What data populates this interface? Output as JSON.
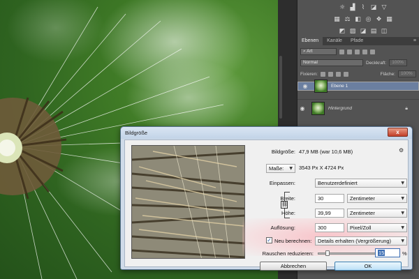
{
  "colors": {
    "selected_layer": "#6b7fa0",
    "dialog_frame": "#cfdbe9",
    "accent": "#3b6db3"
  },
  "panels": {
    "tabs": [
      "Ebenen",
      "Kanäle",
      "Pfade"
    ],
    "filter_label": "Art",
    "blend_mode": "Normal",
    "opacity_label": "Deckkraft:",
    "opacity_value": "100%",
    "lock_label": "Fixieren:",
    "fill_label": "Fläche:",
    "fill_value": "100%",
    "layers": [
      {
        "name": "Ebene 1",
        "selected": true,
        "italic": false
      },
      {
        "name": "Hintergrund",
        "selected": false,
        "italic": true,
        "locked": true
      }
    ]
  },
  "dialog": {
    "title": "Bildgröße",
    "close_label": "x",
    "image_size_label": "Bildgröße:",
    "image_size_value": "47,9 MB (war 10,6 MB)",
    "dimensions_label": "Maße:",
    "dimensions_value": "3543 Px  X  4724 Px",
    "fit_label": "Einpassen:",
    "fit_value": "Benutzerdefiniert",
    "width_label": "Breite:",
    "width_value": "30",
    "width_unit": "Zentimeter",
    "height_label": "Höhe:",
    "height_value": "39,99",
    "height_unit": "Zentimeter",
    "resolution_label": "Auflösung:",
    "resolution_value": "300",
    "resolution_unit": "Pixel/Zoll",
    "resample_label": "Neu berechnen:",
    "resample_checked": true,
    "resample_method": "Details erhalten (Vergrößerung)",
    "noise_label": "Rauschen reduzieren:",
    "noise_value": "15",
    "noise_level": 0.15,
    "percent_sign": "%",
    "cancel_label": "Abbrechen",
    "ok_label": "OK"
  }
}
